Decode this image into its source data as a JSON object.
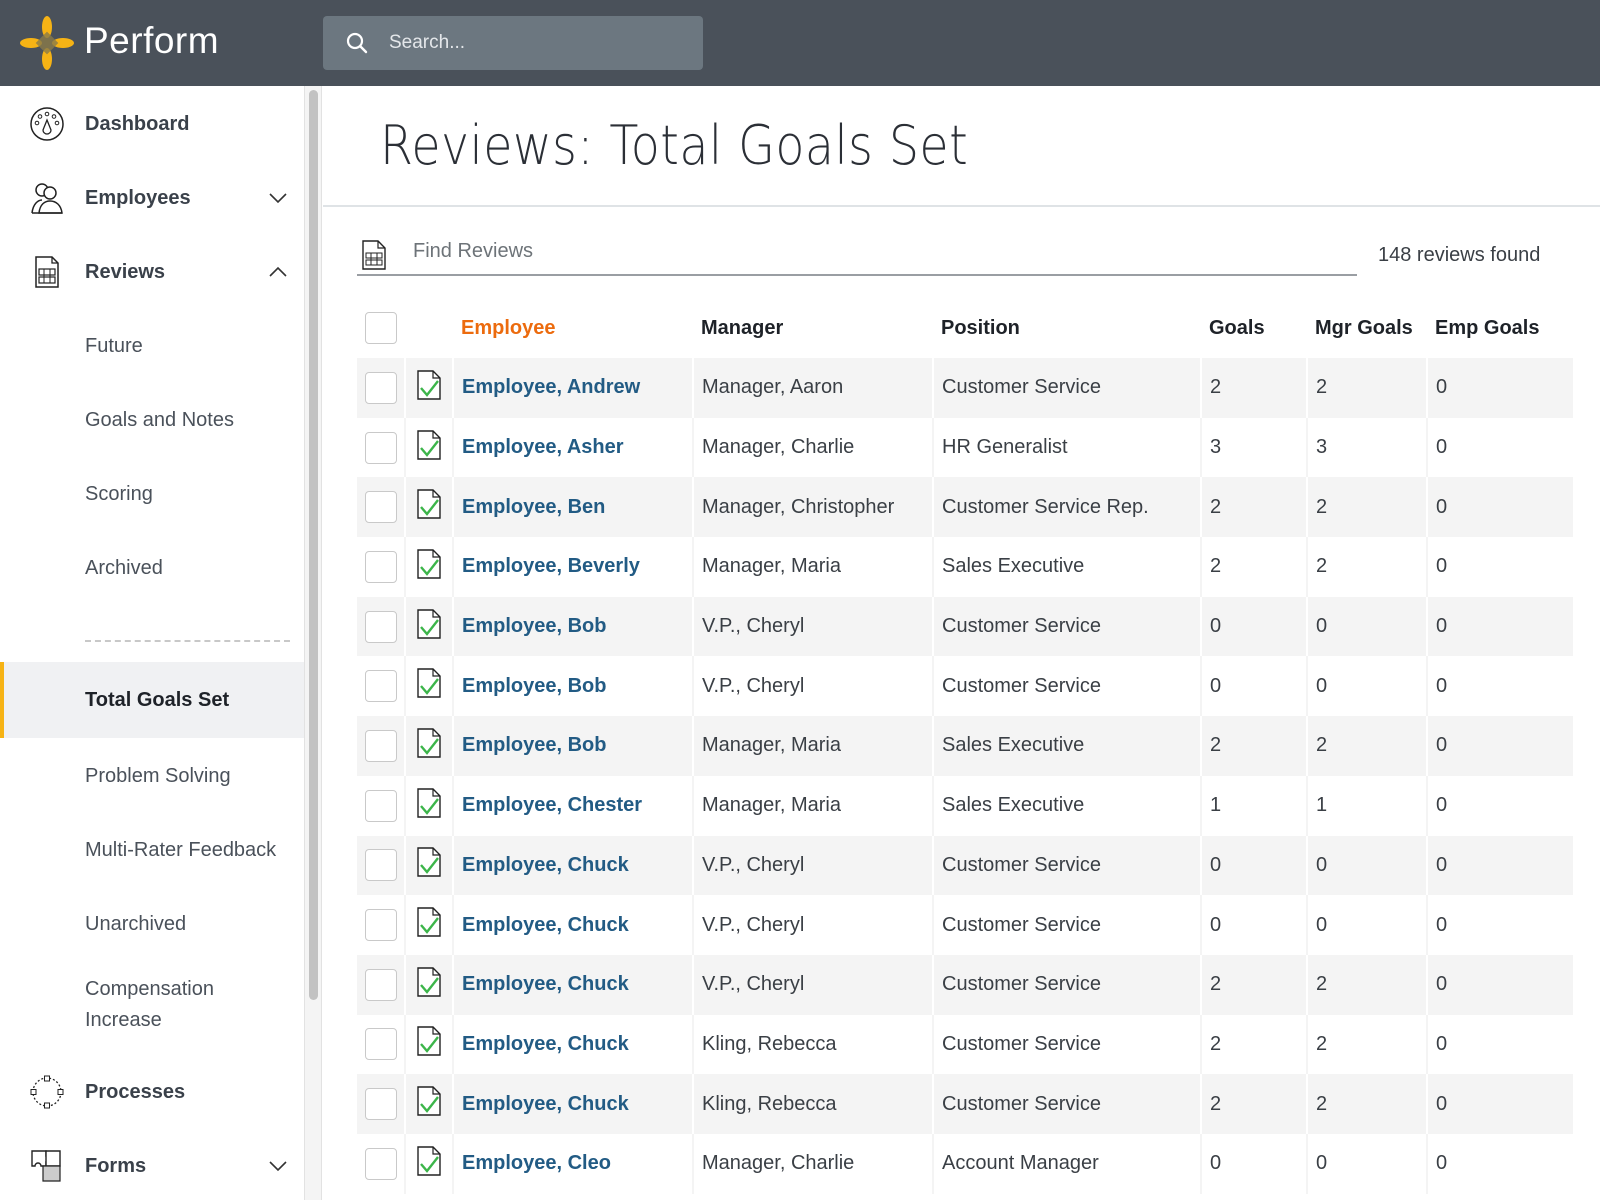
{
  "header": {
    "brand": "Perform",
    "search_placeholder": "Search...",
    "logo_color": "#f6b315"
  },
  "sidebar": {
    "main_items": [
      {
        "label": "Dashboard",
        "icon": "dashboard-gauge-icon"
      },
      {
        "label": "Employees",
        "icon": "people-icon",
        "chevron": "down"
      },
      {
        "label": "Reviews",
        "icon": "review-form-icon",
        "chevron": "up"
      }
    ],
    "review_subitems": [
      {
        "label": "Future"
      },
      {
        "label": "Goals and Notes"
      },
      {
        "label": "Scoring"
      },
      {
        "label": "Archived"
      },
      {
        "label": "Total Goals Set",
        "active": true
      },
      {
        "label": "Problem Solving"
      },
      {
        "label": "Multi-Rater Feedback"
      },
      {
        "label": "Unarchived"
      },
      {
        "label": "Compensation Increase"
      }
    ],
    "bottom_items": [
      {
        "label": "Processes",
        "icon": "process-cycle-icon"
      },
      {
        "label": "Forms",
        "icon": "forms-puzzle-icon",
        "chevron": "down"
      }
    ],
    "active_accent": "#f6b315"
  },
  "main": {
    "title": "Reviews: Total Goals Set",
    "find_placeholder": "Find Reviews",
    "result_count": "148 reviews found",
    "columns": {
      "employee": "Employee",
      "manager": "Manager",
      "position": "Position",
      "goals": "Goals",
      "mgr_goals": "Mgr Goals",
      "emp_goals": "Emp Goals"
    },
    "sorted_column": "Employee",
    "sort_color": "#ec6b0e",
    "link_color": "#225b84",
    "rows": [
      {
        "employee": "Employee, Andrew",
        "manager": "Manager, Aaron",
        "position": "Customer Service",
        "goals": "2",
        "mgr_goals": "2",
        "emp_goals": "0"
      },
      {
        "employee": "Employee, Asher",
        "manager": "Manager, Charlie",
        "position": "HR Generalist",
        "goals": "3",
        "mgr_goals": "3",
        "emp_goals": "0"
      },
      {
        "employee": "Employee, Ben",
        "manager": "Manager, Christopher",
        "position": "Customer Service Rep.",
        "goals": "2",
        "mgr_goals": "2",
        "emp_goals": "0"
      },
      {
        "employee": "Employee, Beverly",
        "manager": "Manager, Maria",
        "position": "Sales Executive",
        "goals": "2",
        "mgr_goals": "2",
        "emp_goals": "0"
      },
      {
        "employee": "Employee, Bob",
        "manager": "V.P., Cheryl",
        "position": "Customer Service",
        "goals": "0",
        "mgr_goals": "0",
        "emp_goals": "0"
      },
      {
        "employee": "Employee, Bob",
        "manager": "V.P., Cheryl",
        "position": "Customer Service",
        "goals": "0",
        "mgr_goals": "0",
        "emp_goals": "0"
      },
      {
        "employee": "Employee, Bob",
        "manager": "Manager, Maria",
        "position": "Sales Executive",
        "goals": "2",
        "mgr_goals": "2",
        "emp_goals": "0"
      },
      {
        "employee": "Employee, Chester",
        "manager": "Manager, Maria",
        "position": "Sales Executive",
        "goals": "1",
        "mgr_goals": "1",
        "emp_goals": "0"
      },
      {
        "employee": "Employee, Chuck",
        "manager": "V.P., Cheryl",
        "position": "Customer Service",
        "goals": "0",
        "mgr_goals": "0",
        "emp_goals": "0"
      },
      {
        "employee": "Employee, Chuck",
        "manager": "V.P., Cheryl",
        "position": "Customer Service",
        "goals": "0",
        "mgr_goals": "0",
        "emp_goals": "0"
      },
      {
        "employee": "Employee, Chuck",
        "manager": "V.P., Cheryl",
        "position": "Customer Service",
        "goals": "2",
        "mgr_goals": "2",
        "emp_goals": "0"
      },
      {
        "employee": "Employee, Chuck",
        "manager": "Kling, Rebecca",
        "position": "Customer Service",
        "goals": "2",
        "mgr_goals": "2",
        "emp_goals": "0"
      },
      {
        "employee": "Employee, Chuck",
        "manager": "Kling, Rebecca",
        "position": "Customer Service",
        "goals": "2",
        "mgr_goals": "2",
        "emp_goals": "0"
      },
      {
        "employee": "Employee, Cleo",
        "manager": "Manager, Charlie",
        "position": "Account Manager",
        "goals": "0",
        "mgr_goals": "0",
        "emp_goals": "0"
      }
    ]
  }
}
